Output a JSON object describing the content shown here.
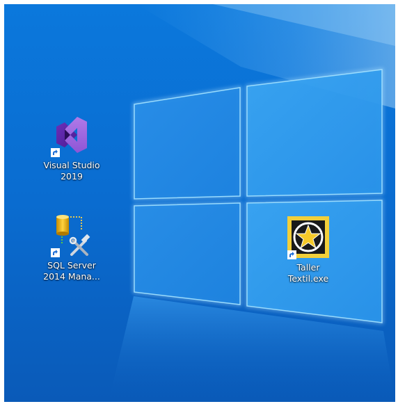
{
  "desktop": {
    "wallpaper": "windows-10-hero",
    "colors": {
      "background": "#0a6fd3",
      "window_panes": "#2f9ff0",
      "pane_glow": "#8fdcff"
    },
    "icons": [
      {
        "label": "Visual Studio\n2019",
        "icon": "visual-studio-icon",
        "shortcut": true
      },
      {
        "label": "SQL Server\n2014 Mana...",
        "icon": "sql-server-management-icon",
        "shortcut": true
      },
      {
        "label": "Taller\nTextil.exe",
        "icon": "taller-textil-star-icon",
        "shortcut": true
      }
    ]
  }
}
